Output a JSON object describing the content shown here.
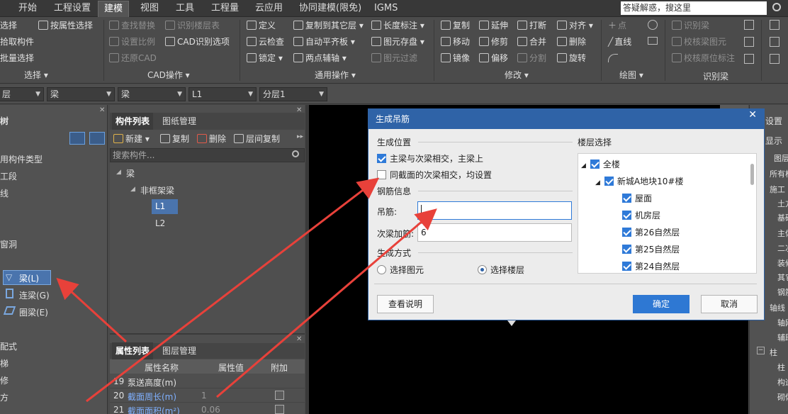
{
  "menubar": {
    "items": [
      "开始",
      "工程设置",
      "建模",
      "视图",
      "工具",
      "工程量",
      "云应用",
      "协同建模(限免)",
      "IGMS"
    ],
    "active": "建模",
    "search_placeholder": "答疑解惑，搜这里"
  },
  "ribbon": {
    "select": {
      "items": [
        "选择",
        "拾取构件",
        "批量选择",
        "按属性选择"
      ],
      "group": "选择 ▾"
    },
    "cad": {
      "items": [
        "查找替换",
        "识别楼层表",
        "设置比例",
        "CAD识别选项",
        "还原CAD"
      ],
      "group": "CAD操作 ▾"
    },
    "common": {
      "items": [
        "定义",
        "复制到其它层 ▾",
        "长度标注 ▾",
        "云检查",
        "自动平齐板 ▾",
        "图元存盘 ▾",
        "锁定 ▾",
        "两点辅轴 ▾",
        "图元过滤"
      ],
      "group": "通用操作 ▾"
    },
    "modify": {
      "items": [
        "复制",
        "延伸",
        "打断",
        "对齐 ▾",
        "移动",
        "修剪",
        "合并",
        "删除",
        "镜像",
        "偏移",
        "分割",
        "旋转"
      ],
      "group": "修改 ▾"
    },
    "draw": {
      "items": [
        "点",
        "直线"
      ],
      "group": "绘图 ▾"
    },
    "recognize": {
      "items": [
        "识别梁",
        "校核梁图元",
        "校核原位标注"
      ],
      "group": "识别梁"
    }
  },
  "toolbar2": {
    "combo1": "层",
    "combo2": "梁",
    "combo3": "梁",
    "combo4": "L1",
    "combo5": "分层1"
  },
  "left_panel": {
    "title": "树",
    "items": [
      "用构件类型",
      "工段",
      "线",
      "窗洞",
      "梁(L)",
      "连梁(G)",
      "圈梁(E)",
      "配式",
      "梯",
      "修",
      "方"
    ]
  },
  "component_list": {
    "tabs": [
      "构件列表",
      "图纸管理"
    ],
    "toolbar": [
      "新建 ▾",
      "复制",
      "删除",
      "层间复制"
    ],
    "search_placeholder": "搜索构件...",
    "tree": [
      "梁",
      "非框架梁",
      "L1",
      "L2"
    ]
  },
  "property_list": {
    "tabs": [
      "属性列表",
      "图层管理"
    ],
    "headers": [
      "属性名称",
      "属性值",
      "附加"
    ],
    "rows": [
      {
        "no": "19",
        "name": "泵送高度(m)",
        "value": ""
      },
      {
        "no": "20",
        "name": "截面周长(m)",
        "value": "1"
      },
      {
        "no": "21",
        "name": "截面面积(m²)",
        "value": "0.06"
      }
    ]
  },
  "right_panel": {
    "title": "设置",
    "items": [
      "显示",
      "图层",
      "所有构",
      "施工",
      "土方",
      "基础",
      "主体",
      "二次",
      "装修",
      "其它",
      "钢筋",
      "轴线",
      "轴网",
      "辅助",
      "柱",
      "柱",
      "构造",
      "砌体"
    ]
  },
  "dialog": {
    "title": "生成吊筋",
    "close": "✕",
    "section_position": "生成位置",
    "opt1": "主梁与次梁相交，主梁上",
    "opt2": "同截面的次梁相交，均设置",
    "section_rebar": "钢筋信息",
    "label_hanger": "吊筋:",
    "hanger_value": "",
    "label_stirrup": "次梁加筋:",
    "stirrup_value": "6",
    "section_mode": "生成方式",
    "mode1": "选择图元",
    "mode2": "选择楼层",
    "section_floor": "楼层选择",
    "floors": [
      "全楼",
      "新城A地块10#楼",
      "屋面",
      "机房层",
      "第26自然层",
      "第25自然层",
      "第24自然层"
    ],
    "btn_help": "查看说明",
    "btn_ok": "确定",
    "btn_cancel": "取消"
  },
  "colors": {
    "accent": "#2f63a7",
    "arrow": "#e8413a"
  }
}
